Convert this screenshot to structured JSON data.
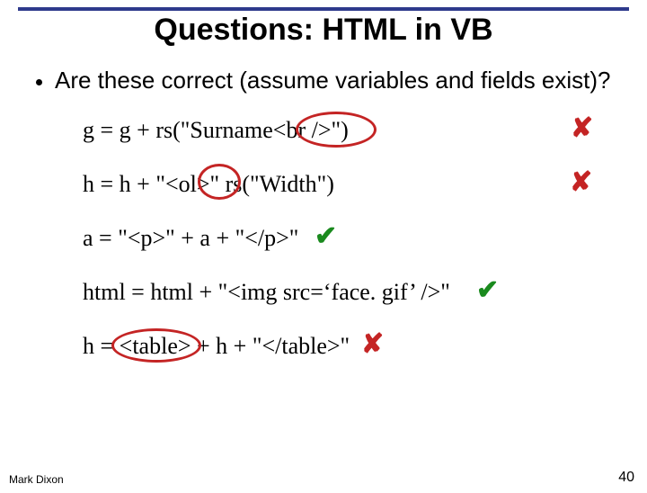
{
  "title": "Questions: HTML in VB",
  "bullet": "Are these correct (assume variables and fields exist)?",
  "items": {
    "i0": "g = g + rs(\"Surname<br />\")",
    "i1": "h = h + \"<ol>\" rs(\"Width\")",
    "i2": "a = \"<p>\" + a + \"</p>\"",
    "i3": "html = html + \"<img src=‘face. gif’ />\"",
    "i4": "h = <table> + h + \"</table>\""
  },
  "marks": {
    "cross": "✘",
    "tick": "✔"
  },
  "footer": {
    "left": "Mark Dixon",
    "right": "40"
  }
}
